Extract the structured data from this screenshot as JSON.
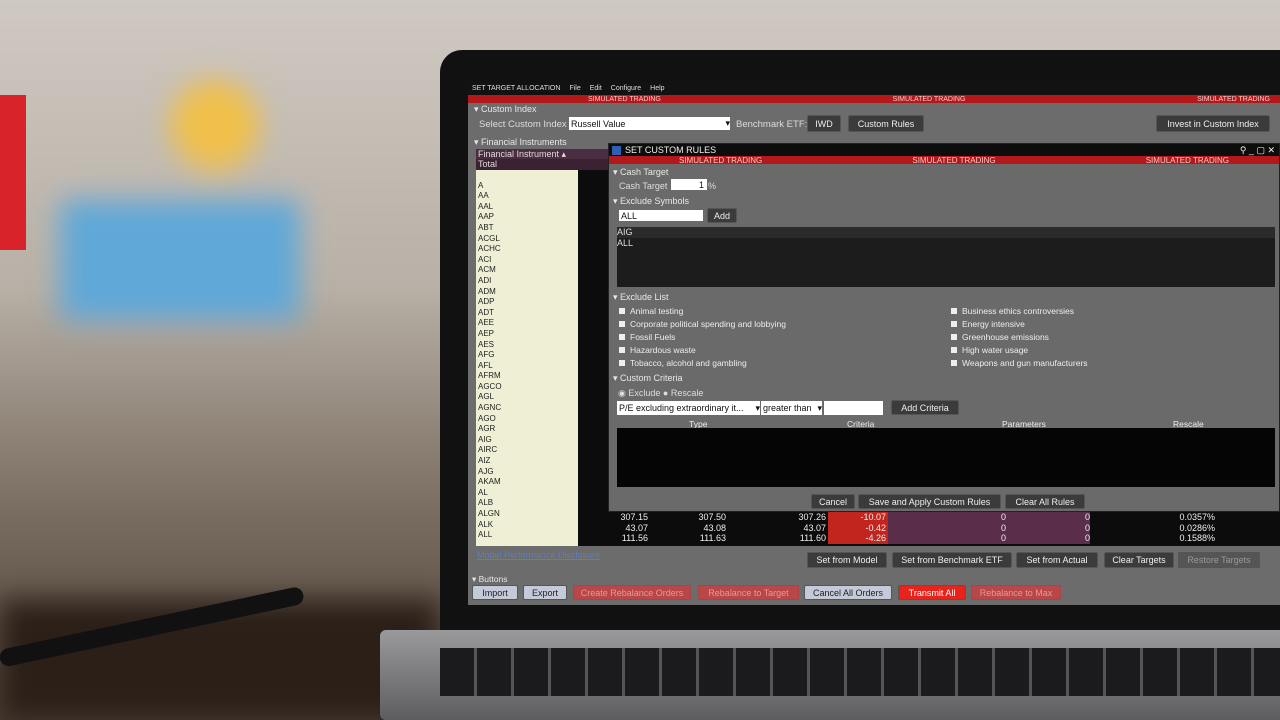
{
  "window": {
    "title": "SET TARGET ALLOCATION",
    "menu": [
      "File",
      "Edit",
      "Configure",
      "Help"
    ],
    "banner": "SIMULATED TRADING"
  },
  "custom_index": {
    "section": "Custom Index",
    "select_label": "Select Custom Index",
    "selected": "Russell Value",
    "benchmark_label": "Benchmark ETF:",
    "benchmark": "IWD",
    "custom_rules": "Custom Rules",
    "invest": "Invest in Custom Index"
  },
  "instruments": {
    "section": "Financial Instruments",
    "column": "Financial Instrument ▴",
    "total": "Total",
    "symbols": [
      "",
      "A",
      "AA",
      "AAL",
      "AAP",
      "ABT",
      "ACGL",
      "ACHC",
      "ACI",
      "ACM",
      "ADI",
      "ADM",
      "ADP",
      "ADT",
      "AEE",
      "AEP",
      "AES",
      "AFG",
      "AFL",
      "AFRM",
      "AGCO",
      "AGL",
      "AGNC",
      "AGO",
      "AGR",
      "AIG",
      "AIRC",
      "AIZ",
      "AJG",
      "AKAM",
      "AL",
      "ALB",
      "ALGN",
      "ALK",
      "ALL"
    ]
  },
  "rows": [
    {
      "c1": "307.15",
      "c2": "307.50",
      "c3": "307.26",
      "c4": "-10.07",
      "c5": "0",
      "c6": "0",
      "c7": "0.0357%"
    },
    {
      "c1": "43.07",
      "c2": "43.08",
      "c3": "43.07",
      "c4": "-0.42",
      "c5": "0",
      "c6": "0",
      "c7": "0.0286%"
    },
    {
      "c1": "111.56",
      "c2": "111.63",
      "c3": "111.60",
      "c4": "-4.26",
      "c5": "0",
      "c6": "0",
      "c7": "0.1588%"
    }
  ],
  "link": "Model Performance Disclosure",
  "target_buttons": [
    "Set from Model",
    "Set from Benchmark ETF",
    "Set from Actual",
    "Clear Targets",
    "Restore Targets"
  ],
  "buttons": {
    "section": "Buttons",
    "items": [
      "Import",
      "Export",
      "Create Rebalance Orders",
      "Rebalance to Target",
      "Cancel All Orders",
      "Transmit All",
      "Rebalance to Max"
    ]
  },
  "dialog": {
    "title": "SET CUSTOM RULES",
    "cash": {
      "section": "Cash Target",
      "label": "Cash Target",
      "value": "1",
      "unit": "%"
    },
    "exclude_symbols": {
      "section": "Exclude Symbols",
      "input": "ALL",
      "add": "Add",
      "list": [
        "AIG",
        "ALL"
      ]
    },
    "exclude_list": {
      "section": "Exclude List",
      "left": [
        "Animal testing",
        "Corporate political spending and lobbying",
        "Fossil Fuels",
        "Hazardous waste",
        "Tobacco, alcohol and gambling"
      ],
      "right": [
        "Business ethics controversies",
        "Energy intensive",
        "Greenhouse emissions",
        "High water usage",
        "Weapons and gun manufacturers"
      ]
    },
    "criteria": {
      "section": "Custom Criteria",
      "exclude": "Exclude",
      "rescale": "Rescale",
      "field": "P/E excluding extraordinary it...",
      "op": "greater than",
      "value": "",
      "add": "Add Criteria",
      "columns": [
        "Type",
        "Criteria",
        "Parameters",
        "Rescale"
      ]
    },
    "footer": [
      "Cancel",
      "Save and Apply Custom Rules",
      "Clear All Rules"
    ]
  }
}
